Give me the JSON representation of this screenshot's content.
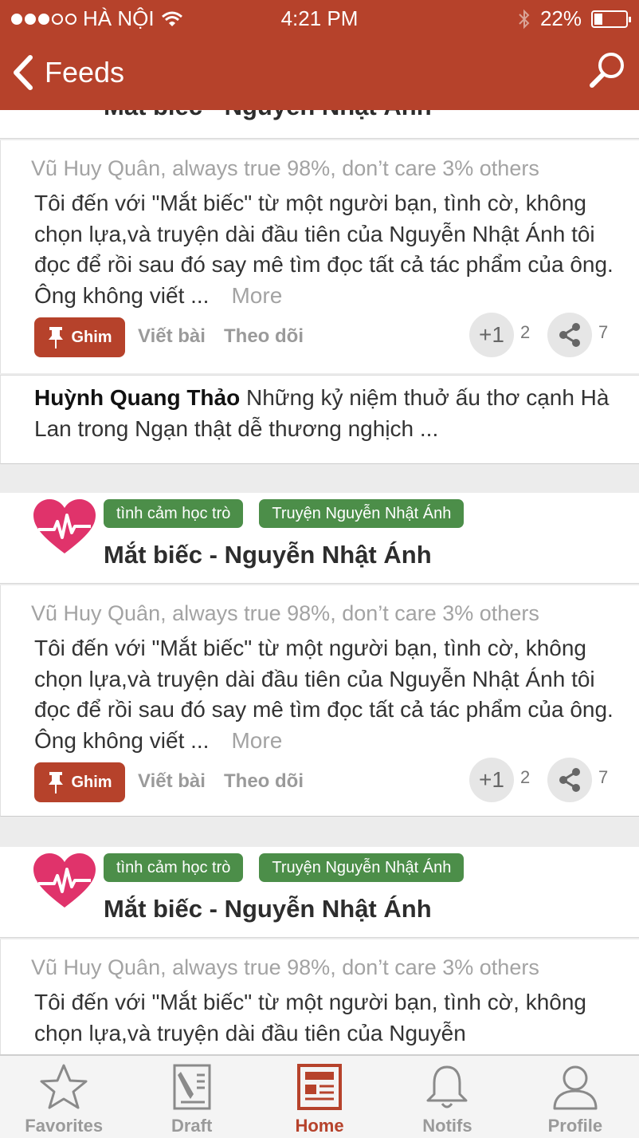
{
  "status_bar": {
    "carrier": "HÀ NỘI",
    "time": "4:21 PM",
    "battery": "22%",
    "battery_level": 0.22
  },
  "nav": {
    "back_label": "Feeds"
  },
  "feed": [
    {
      "book_title": "Mắt biếc - Nguyễn Nhật Ánh",
      "author": "Vũ Huy Quân,  always true 98%, don’t care 3% others",
      "body": "Tôi đến với \"Mắt biếc\"  từ một người bạn, tình cờ, không chọn lựa,và truyện dài đầu tiên của Nguyễn Nhật Ánh tôi đọc để rồi sau đó say mê tìm đọc tất cả tác phẩm của ông. Ông không viết ...",
      "more": "More",
      "ghim": "Ghim",
      "write": "Viết bài",
      "follow": "Theo dõi",
      "plus_label": "+1",
      "plus_count": "2",
      "share_count": "7",
      "comment_name": "Huỳnh Quang Thảo",
      "comment_text": "Những kỷ niệm thuở ấu thơ cạnh Hà Lan trong Ngạn thật dễ thương nghịch ..."
    },
    {
      "tags": [
        "tình cảm học trò",
        "Truyện Nguyễn Nhật Ánh"
      ],
      "book_title": "Mắt biếc - Nguyễn Nhật Ánh",
      "author": "Vũ Huy Quân,  always true 98%, don’t care 3% others",
      "body": "Tôi đến với \"Mắt biếc\"  từ một người bạn, tình cờ, không chọn lựa,và truyện dài đầu tiên của Nguyễn Nhật Ánh tôi đọc để rồi sau đó say mê tìm đọc tất cả tác phẩm của ông. Ông không viết ...",
      "more": "More",
      "ghim": "Ghim",
      "write": "Viết bài",
      "follow": "Theo dõi",
      "plus_label": "+1",
      "plus_count": "2",
      "share_count": "7"
    },
    {
      "tags": [
        "tình cảm học trò",
        "Truyện Nguyễn Nhật Ánh"
      ],
      "book_title": "Mắt biếc - Nguyễn Nhật Ánh",
      "author": "Vũ Huy Quân,  always true 98%, don’t care 3% others",
      "body": "Tôi đến với \"Mắt biếc\"  từ một người bạn, tình cờ, không chọn lựa,và truyện dài đầu tiên của Nguyễn"
    }
  ],
  "tabbar": {
    "tabs": [
      {
        "label": "Favorites",
        "icon": "star-icon"
      },
      {
        "label": "Draft",
        "icon": "draft-icon"
      },
      {
        "label": "Home",
        "icon": "newspaper-icon",
        "active": true
      },
      {
        "label": "Notifs",
        "icon": "bell-icon"
      },
      {
        "label": "Profile",
        "icon": "person-icon"
      }
    ]
  },
  "colors": {
    "brand": "#b6422b",
    "tag_green": "#4c8e49",
    "heart_pink": "#e0336b"
  }
}
